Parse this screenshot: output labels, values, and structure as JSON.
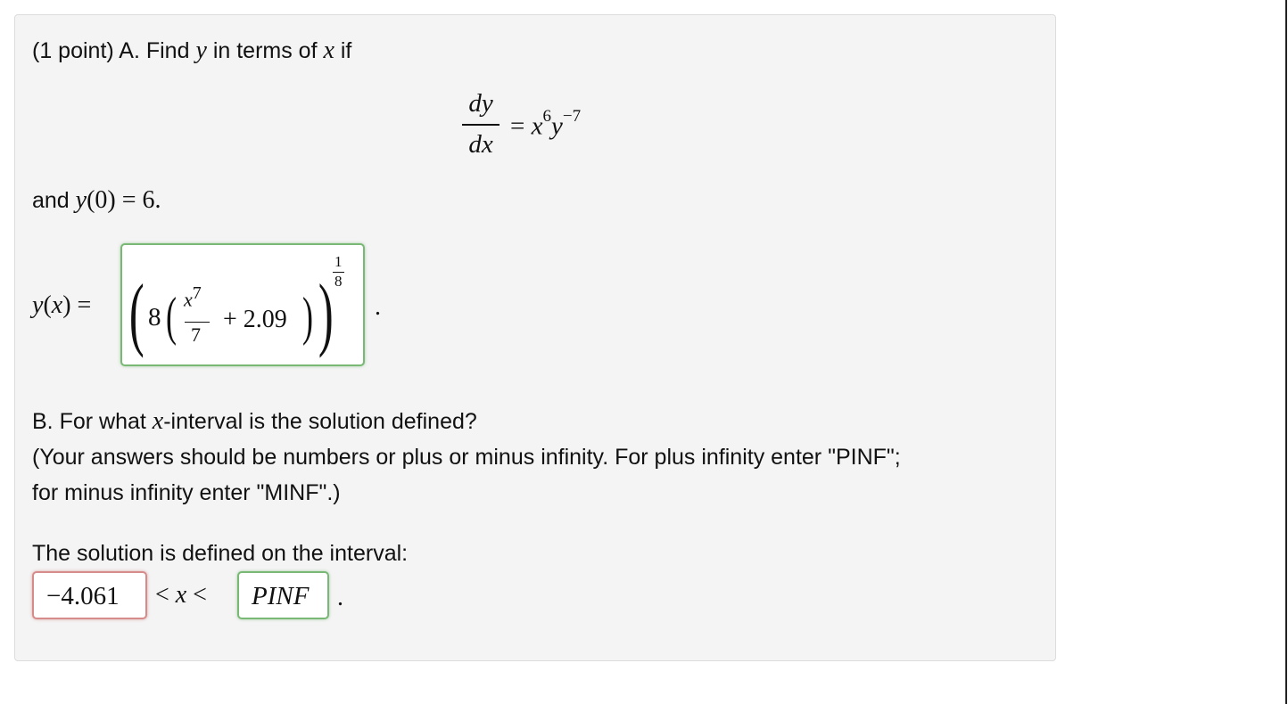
{
  "partA": {
    "intro_before": "(1 point) A. Find ",
    "y_var": "y",
    "intro_mid": " in terms of ",
    "x_var": "x",
    "intro_after": " if",
    "eq_numerator": "dy",
    "eq_denominator": "dx",
    "eq_equals": "=",
    "eq_x": "x",
    "eq_x_exp": "6",
    "eq_y": "y",
    "eq_y_exp": "−7",
    "condition_prefix": "and ",
    "condition_y": "y",
    "condition_rest": "(0) = 6.",
    "answer_label_y": "y",
    "answer_label_paren_open": "(",
    "answer_label_x": "x",
    "answer_label_rest": ") =",
    "answer_status": "correct",
    "answer_coeff": "8",
    "answer_frac_num_x": "x",
    "answer_frac_num_exp": "7",
    "answer_frac_den": "7",
    "answer_plus": "+ 2.09",
    "answer_exp_num": "1",
    "answer_exp_den": "8",
    "answer_trailing_dot": "."
  },
  "partB": {
    "question_prefix": "B. For what ",
    "question_var": "x",
    "question_suffix": "-interval is the solution defined?",
    "note_line1": "(Your answers should be numbers or plus or minus infinity. For plus infinity enter \"PINF\";",
    "note_line2": "for minus infinity enter \"MINF\".)",
    "interval_label": "The solution is defined on the interval:",
    "lower_value": "−4.061",
    "lower_status": "incorrect",
    "middle_lt1": "<",
    "middle_x": "x",
    "middle_lt2": "<",
    "upper_value": "PINF",
    "upper_status": "correct",
    "trailing_dot": "."
  },
  "colors": {
    "panel_bg": "#f4f4f4",
    "correct_border": "#7ab876",
    "incorrect_border": "#d78c8c"
  }
}
